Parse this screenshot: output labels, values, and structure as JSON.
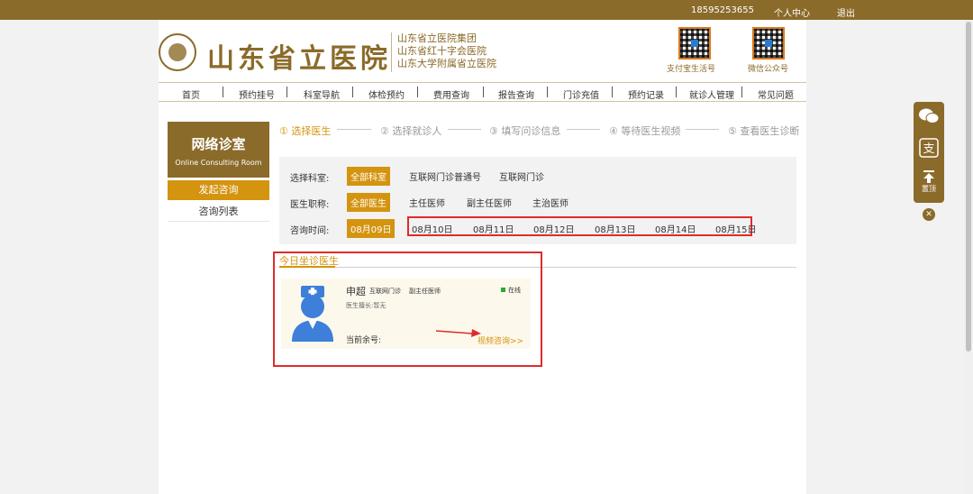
{
  "topbar": {
    "phone": "18595253655",
    "personal_center": "个人中心",
    "logout": "退出"
  },
  "header": {
    "logo_text": "山东省立医院",
    "sub_names": [
      "山东省立医院集团",
      "山东省红十字会医院",
      "山东大学附属省立医院"
    ],
    "qr_alipay_label": "支付宝生活号",
    "qr_wechat_label": "微信公众号"
  },
  "nav": [
    "首页",
    "预约挂号",
    "科室导航",
    "体检预约",
    "费用查询",
    "报告查询",
    "门诊充值",
    "预约记录",
    "就诊人管理",
    "常见问题"
  ],
  "sidebar": {
    "title": "网络诊室",
    "subtitle": "Online Consulting Room",
    "start_consult": "发起咨询",
    "consult_list": "咨询列表"
  },
  "steps": [
    "① 选择医生",
    "② 选择就诊人",
    "③ 填写问诊信息",
    "④ 等待医生视频",
    "⑤ 查看医生诊断"
  ],
  "filter": {
    "dept_label": "选择科室:",
    "dept_options": [
      "全部科室",
      "互联网门诊普通号",
      "互联网门诊"
    ],
    "title_label": "医生职称:",
    "title_options": [
      "全部医生",
      "主任医师",
      "副主任医师",
      "主治医师"
    ],
    "time_label": "咨询时间:",
    "time_options": [
      "08月09日",
      "08月10日",
      "08月11日",
      "08月12日",
      "08月13日",
      "08月14日",
      "08月15日"
    ]
  },
  "today": {
    "tab": "今日坐诊医生",
    "doctor": {
      "name": "申超",
      "dept": "互联网门诊",
      "title": "副主任医师",
      "status": "在线",
      "specialty": "医生擅长:暂无",
      "remain_label": "当前余号:",
      "consult_link": "视频咨询>>"
    }
  },
  "float_bar": {
    "top_label": "置顶",
    "close": "✕"
  },
  "colors": {
    "brand": "#8b6b2a",
    "accent": "#d4940f",
    "highlight": "#e02b2b"
  }
}
